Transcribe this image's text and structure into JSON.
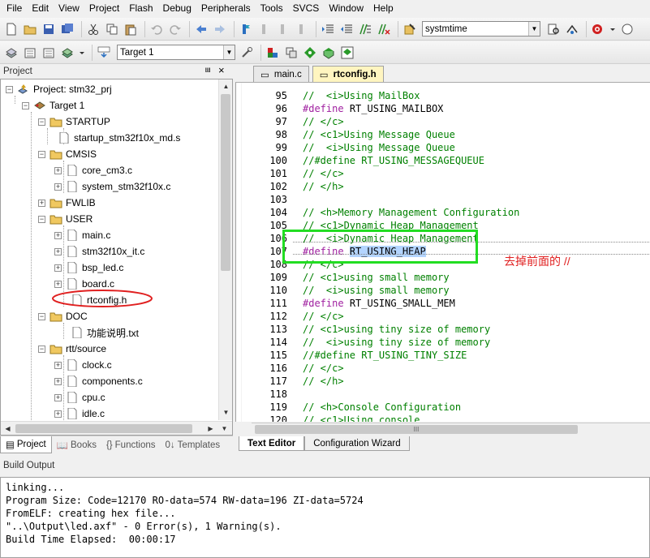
{
  "menubar": {
    "items": [
      "File",
      "Edit",
      "View",
      "Project",
      "Flash",
      "Debug",
      "Peripherals",
      "Tools",
      "SVCS",
      "Window",
      "Help"
    ]
  },
  "toolbar1": {
    "search_value": "systmtime"
  },
  "toolbar2": {
    "target_value": "Target 1"
  },
  "project_panel": {
    "title": "Project",
    "pin_glyph": "⩏",
    "close_glyph": "×",
    "tree": {
      "root": "Project: stm32_prj",
      "target": "Target 1",
      "groups": [
        {
          "name": "STARTUP",
          "files": [
            "startup_stm32f10x_md.s"
          ]
        },
        {
          "name": "CMSIS",
          "files": [
            "core_cm3.c",
            "system_stm32f10x.c"
          ]
        },
        {
          "name": "FWLIB",
          "files": []
        },
        {
          "name": "USER",
          "files": [
            "main.c",
            "stm32f10x_it.c",
            "bsp_led.c",
            "board.c",
            "rtconfig.h"
          ]
        },
        {
          "name": "DOC",
          "files": [
            "功能说明.txt"
          ]
        },
        {
          "name": "rtt/source",
          "files": [
            "clock.c",
            "components.c",
            "cpu.c",
            "idle.c"
          ]
        }
      ]
    },
    "bottom_tabs": [
      "Project",
      "Books",
      "Functions",
      "Templates"
    ]
  },
  "editor": {
    "tabs": [
      "main.c",
      "rtconfig.h"
    ],
    "active_tab": "rtconfig.h",
    "lines": [
      {
        "n": "95",
        "text": "//  <i>Using MailBox",
        "type": "comment"
      },
      {
        "n": "96",
        "text": "#define RT_USING_MAILBOX",
        "type": "define"
      },
      {
        "n": "97",
        "text": "// </c>",
        "type": "comment"
      },
      {
        "n": "98",
        "text": "// <c1>Using Message Queue",
        "type": "comment"
      },
      {
        "n": "99",
        "text": "//  <i>Using Message Queue",
        "type": "comment"
      },
      {
        "n": "100",
        "text": "//#define RT_USING_MESSAGEQUEUE",
        "type": "comment"
      },
      {
        "n": "101",
        "text": "// </c>",
        "type": "comment"
      },
      {
        "n": "102",
        "text": "// </h>",
        "type": "comment"
      },
      {
        "n": "103",
        "text": "",
        "type": "comment"
      },
      {
        "n": "104",
        "text": "// <h>Memory Management Configuration",
        "type": "comment"
      },
      {
        "n": "105",
        "text": "// <c1>Dynamic Heap Management",
        "type": "comment"
      },
      {
        "n": "106",
        "text": "//  <i>Dynamic Heap Management",
        "type": "comment"
      },
      {
        "n": "107",
        "text": "#define RT_USING_HEAP",
        "type": "define_sel"
      },
      {
        "n": "108",
        "text": "// </c>",
        "type": "comment"
      },
      {
        "n": "109",
        "text": "// <c1>using small memory",
        "type": "comment"
      },
      {
        "n": "110",
        "text": "//  <i>using small memory",
        "type": "comment"
      },
      {
        "n": "111",
        "text": "#define RT_USING_SMALL_MEM",
        "type": "define"
      },
      {
        "n": "112",
        "text": "// </c>",
        "type": "comment"
      },
      {
        "n": "113",
        "text": "// <c1>using tiny size of memory",
        "type": "comment"
      },
      {
        "n": "114",
        "text": "//  <i>using tiny size of memory",
        "type": "comment"
      },
      {
        "n": "115",
        "text": "//#define RT_USING_TINY_SIZE",
        "type": "comment"
      },
      {
        "n": "116",
        "text": "// </c>",
        "type": "comment"
      },
      {
        "n": "117",
        "text": "// </h>",
        "type": "comment"
      },
      {
        "n": "118",
        "text": "",
        "type": "comment"
      },
      {
        "n": "119",
        "text": "// <h>Console Configuration",
        "type": "comment"
      },
      {
        "n": "120",
        "text": "// <c1>Using console",
        "type": "comment"
      }
    ],
    "annotation": "去掉前面的 //",
    "bottom_tabs": [
      "Text Editor",
      "Configuration Wizard"
    ],
    "hscroll_glyph": "III"
  },
  "build_output": {
    "title": "Build Output",
    "lines": [
      "linking...",
      "Program Size: Code=12170 RO-data=574 RW-data=196 ZI-data=5724",
      "FromELF: creating hex file...",
      "\"..\\Output\\led.axf\" - 0 Error(s), 1 Warning(s).",
      "Build Time Elapsed:  00:00:17"
    ]
  },
  "colors": {
    "comment": "#008000",
    "keyword": "#a020a0",
    "selection": "#b3d4ff",
    "highlight_box": "#22dd22",
    "red_ellipse": "#e02020"
  }
}
